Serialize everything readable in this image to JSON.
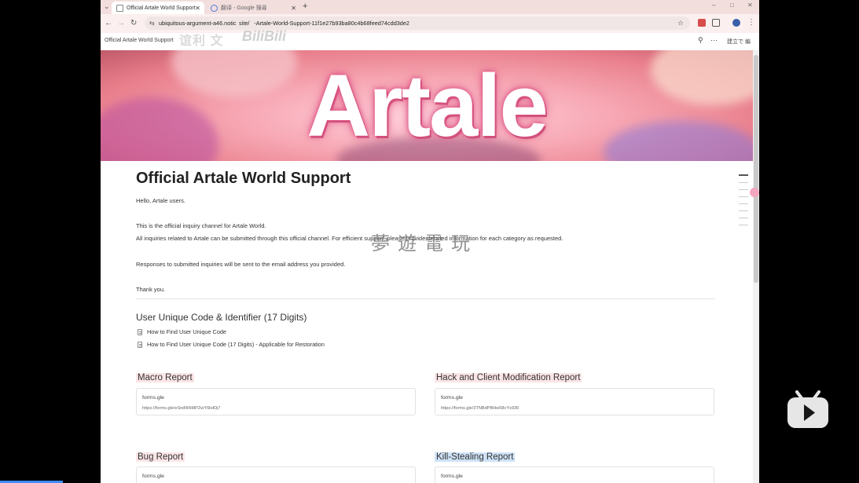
{
  "browser": {
    "tabs": [
      {
        "title": "Official Artale World Support",
        "active": true
      },
      {
        "title": "翻译 - Google 搜尋",
        "active": false
      }
    ],
    "url": "ubiquitous-argument-a46.notic  site/    -Artale-World-Support-11f1e27b93ba80c4b68feed74cdd3de2",
    "new_tab_label": "+",
    "window_controls": [
      "–",
      "□",
      "✕"
    ]
  },
  "notion": {
    "breadcrumb": "Official Artale World Support",
    "overlay_text_1": "谊利 文",
    "overlay_text_2": "BiliBili",
    "actions_label": "建立で 編"
  },
  "banner": {
    "logo_text": "Artale"
  },
  "page": {
    "title": "Official Artale World Support",
    "greeting": "Hello, Artale users.",
    "line1": "This is the official inquiry channel for Artale World.",
    "line2": "All inquiries related to Artale can be submitted through this official channel. For efficient support, please provide detailed information for each category as requested.",
    "line3": "Responses to submitted inquiries will be sent to the email address you provided.",
    "thanks": "Thank you.",
    "watermark": "夢遊電玩",
    "unique_code_heading": "User Unique Code & Identifier (17 Digits)",
    "links": [
      "How to Find User Unique Code",
      "How to Find User Unique Code (17 Digits) - Applicable for Restoration"
    ],
    "sections": [
      {
        "title": "Macro Report",
        "host": "forms.gle",
        "url": "https://forms.gle/eSndWkMPZwY6kdDj7"
      },
      {
        "title": "Hack and Client Modification Report",
        "host": "forms.gle",
        "url": "https://forms.gle/3TNBdPBHw58cYx936"
      },
      {
        "title": "Bug Report",
        "host": "forms.gle",
        "url": ""
      },
      {
        "title": "Kill-Stealing Report",
        "host": "forms.gle",
        "url": ""
      }
    ]
  },
  "colors": {
    "tabstrip": "#f3dede",
    "highlight_pink": "#fbe5e7",
    "highlight_blue": "#cfe3f7",
    "bilibili_play": "#e6e6e6"
  }
}
